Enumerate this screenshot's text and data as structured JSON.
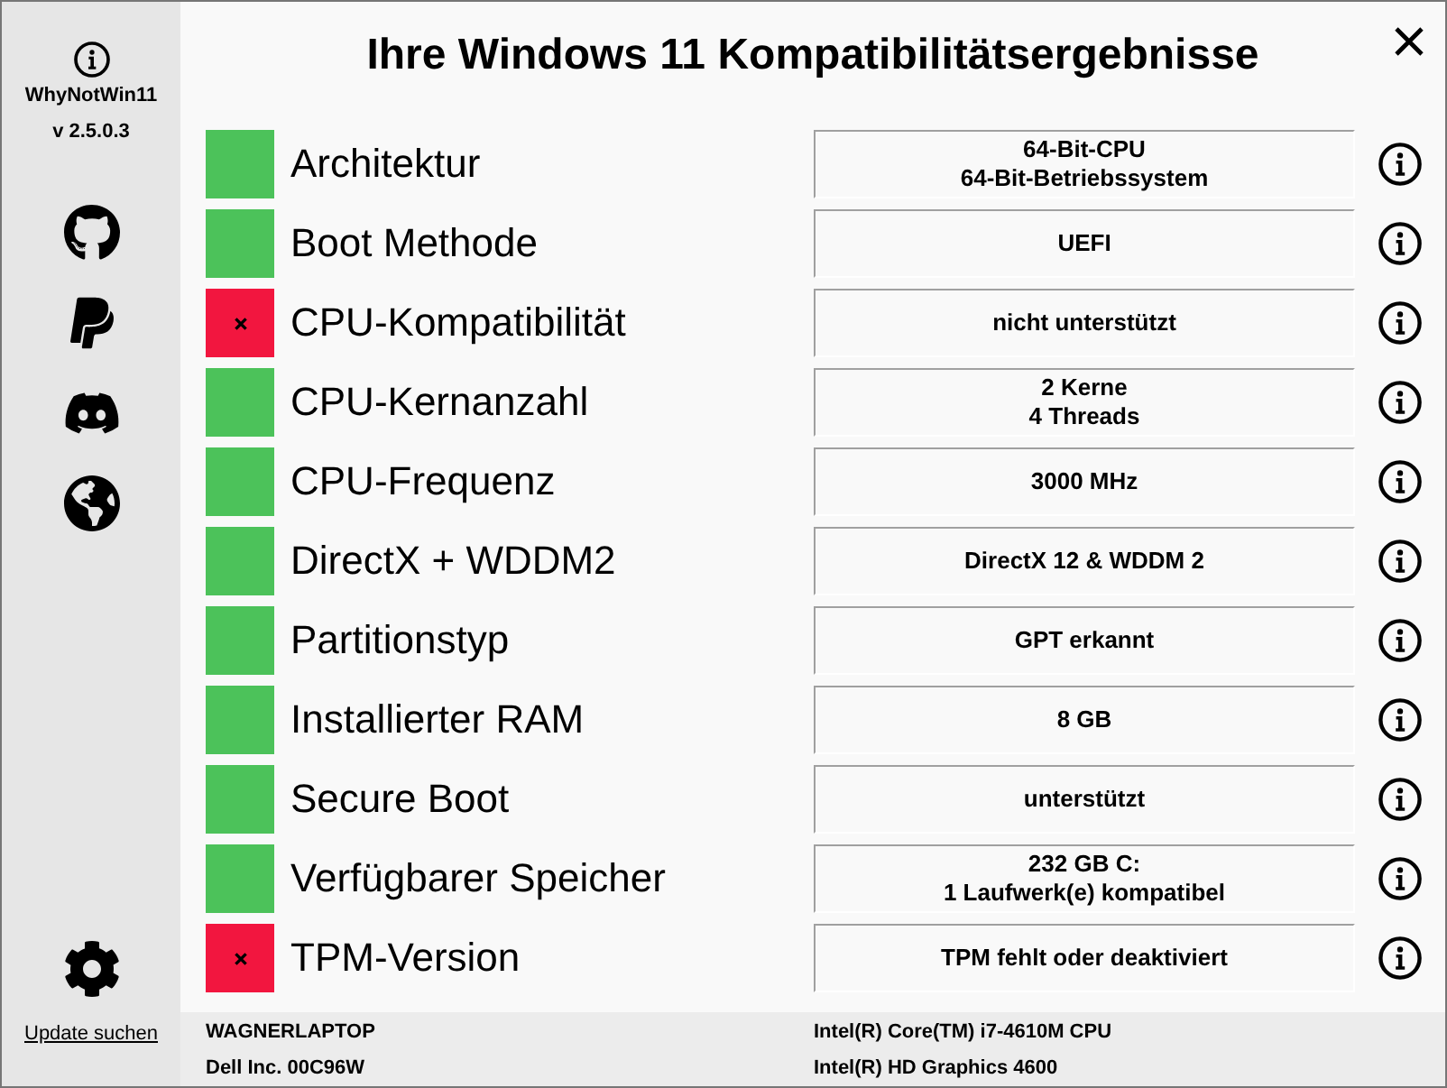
{
  "window": {
    "title": "Ihre Windows 11 Kompatibilitätsergebnisse"
  },
  "sidebar": {
    "app_name": "WhyNotWin11",
    "version": "v 2.5.0.3",
    "update_link": "Update suchen"
  },
  "checks": [
    {
      "label": "Architektur",
      "passed": true,
      "value_lines": [
        "64-Bit-CPU",
        "64-Bit-Betriebssystem"
      ]
    },
    {
      "label": "Boot Methode",
      "passed": true,
      "value_lines": [
        "UEFI"
      ]
    },
    {
      "label": "CPU-Kompatibilität",
      "passed": false,
      "value_lines": [
        "nicht unterstützt"
      ]
    },
    {
      "label": "CPU-Kernanzahl",
      "passed": true,
      "value_lines": [
        "2 Kerne",
        "4 Threads"
      ]
    },
    {
      "label": "CPU-Frequenz",
      "passed": true,
      "value_lines": [
        "3000 MHz"
      ]
    },
    {
      "label": "DirectX + WDDM2",
      "passed": true,
      "value_lines": [
        "DirectX 12 & WDDM 2"
      ]
    },
    {
      "label": "Partitionstyp",
      "passed": true,
      "value_lines": [
        "GPT erkannt"
      ]
    },
    {
      "label": "Installierter RAM",
      "passed": true,
      "value_lines": [
        "8 GB"
      ]
    },
    {
      "label": "Secure Boot",
      "passed": true,
      "value_lines": [
        "unterstützt"
      ]
    },
    {
      "label": "Verfügbarer Speicher",
      "passed": true,
      "value_lines": [
        "232 GB C:",
        "1 Laufwerk(e) kompatibel"
      ]
    },
    {
      "label": "TPM-Version",
      "passed": false,
      "value_lines": [
        "TPM fehlt oder deaktiviert"
      ]
    }
  ],
  "status_bar": {
    "computer_name": "WAGNERLAPTOP",
    "board": "Dell Inc. 00C96W",
    "cpu": "Intel(R) Core(TM) i7-4610M CPU",
    "gpu": "Intel(R) HD Graphics 4600"
  }
}
